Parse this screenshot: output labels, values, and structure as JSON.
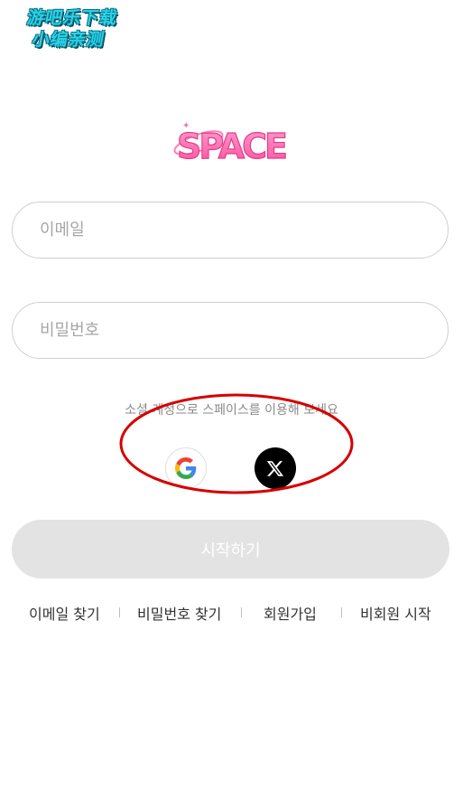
{
  "watermark": {
    "line1": "游吧乐下载",
    "line2": "小编亲测"
  },
  "logo": {
    "text": "SPACE",
    "color": "#ff6fb0"
  },
  "login": {
    "email_placeholder": "이메일",
    "password_placeholder": "비밀번호",
    "social_label": "소셜 계정으로 스페이스를 이용해 보세요",
    "social_buttons": [
      {
        "icon": "google-icon"
      },
      {
        "icon": "x-icon"
      }
    ],
    "start_label": "시작하기"
  },
  "links": {
    "find_email": "이메일 찾기",
    "find_password": "비밀번호 찾기",
    "signup": "회원가입",
    "guest_start": "비회원 시작"
  },
  "colors": {
    "field_border": "#cfcfcf",
    "start_disabled_bg": "#e3e3e3",
    "highlight_ring": "#d60000"
  }
}
